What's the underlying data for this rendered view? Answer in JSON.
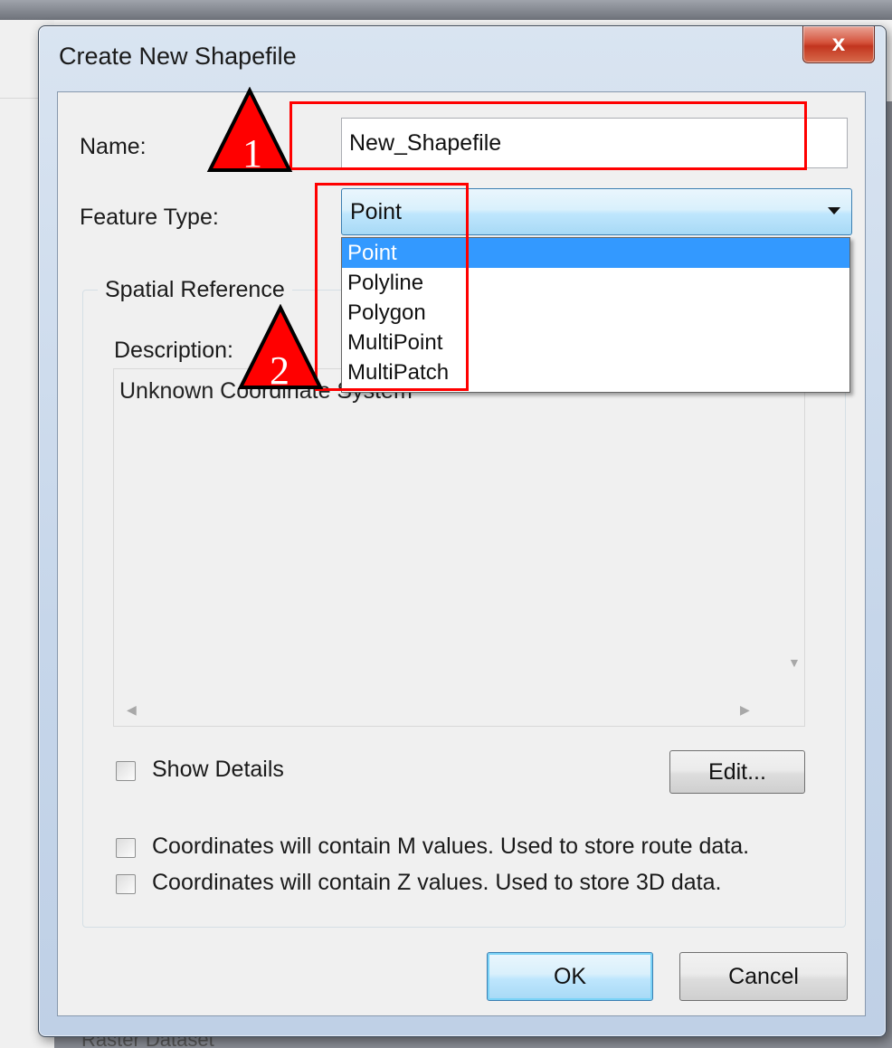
{
  "dialog": {
    "title": "Create New Shapefile",
    "close_glyph": "x",
    "name_label": "Name:",
    "name_value": "New_Shapefile",
    "feature_type_label": "Feature Type:",
    "feature_type_selected": "Point",
    "feature_type_options": [
      "Point",
      "Polyline",
      "Polygon",
      "MultiPoint",
      "MultiPatch"
    ],
    "spatial_reference": {
      "group_title": "Spatial Reference",
      "description_label": "Description:",
      "description_text": "Unknown Coordinate System",
      "show_details_label": "Show Details",
      "edit_button": "Edit..."
    },
    "m_values_label": "Coordinates will contain M values. Used to store route data.",
    "z_values_label": "Coordinates will contain Z values. Used to store 3D data.",
    "ok_button": "OK",
    "cancel_button": "Cancel"
  },
  "annotations": {
    "marker_1": "1",
    "marker_2": "2",
    "color": "#ff0000"
  },
  "background": {
    "peek_text": "Raster Dataset"
  }
}
